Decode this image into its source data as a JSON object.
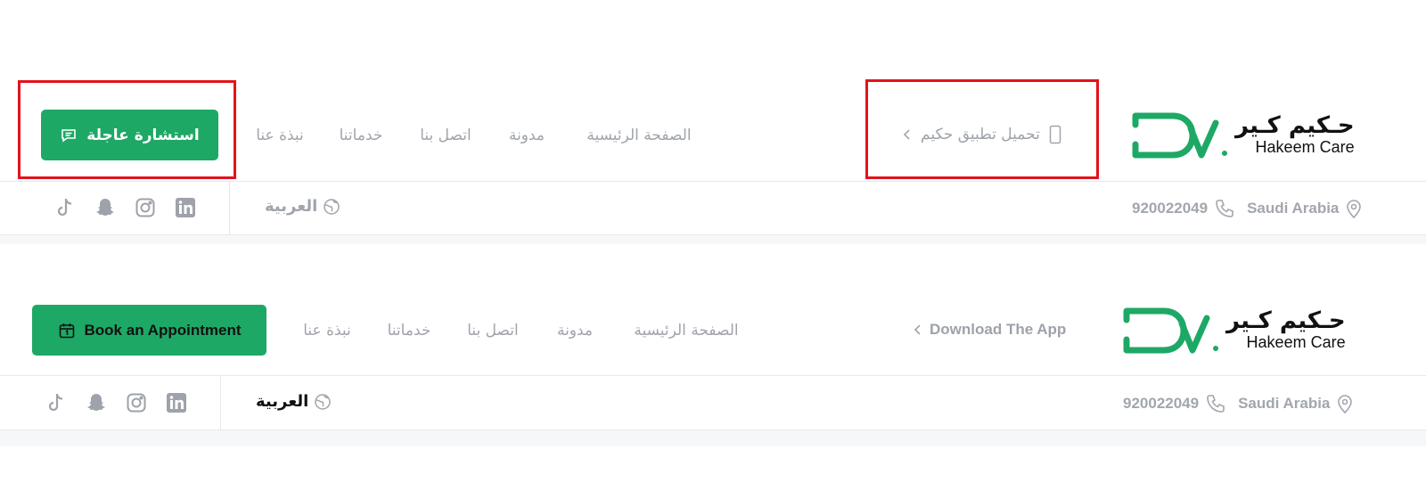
{
  "colors": {
    "accent": "#1ea866",
    "annotation": "#e3131b",
    "muted": "#a0a4ab"
  },
  "logo": {
    "arabic": "حـكيم كـير",
    "english": "Hakeem Care",
    "icon": "dr-stethoscope-logo-icon"
  },
  "header_ar": {
    "cta_label": "استشارة عاجلة",
    "cta_icon": "chat-icon",
    "app_link": "تحميل تطبيق حكيم",
    "app_icon": "phone-icon",
    "nav": [
      "الصفحة الرئيسية",
      "مدونة",
      "اتصل بنا",
      "خدماتنا",
      "نبذة عنا"
    ],
    "language": "العربية",
    "location": "Saudi Arabia",
    "phone": "920022049"
  },
  "header_en": {
    "cta_label": "Book an Appointment",
    "cta_icon": "calendar-icon",
    "app_link": "Download The App",
    "nav": [
      "الصفحة الرئيسية",
      "مدونة",
      "اتصل بنا",
      "خدماتنا",
      "نبذة عنا"
    ],
    "language": "العربية",
    "location": "Saudi Arabia",
    "phone": "920022049"
  },
  "social_icons": [
    "tiktok-icon",
    "snapchat-icon",
    "instagram-icon",
    "linkedin-icon"
  ]
}
